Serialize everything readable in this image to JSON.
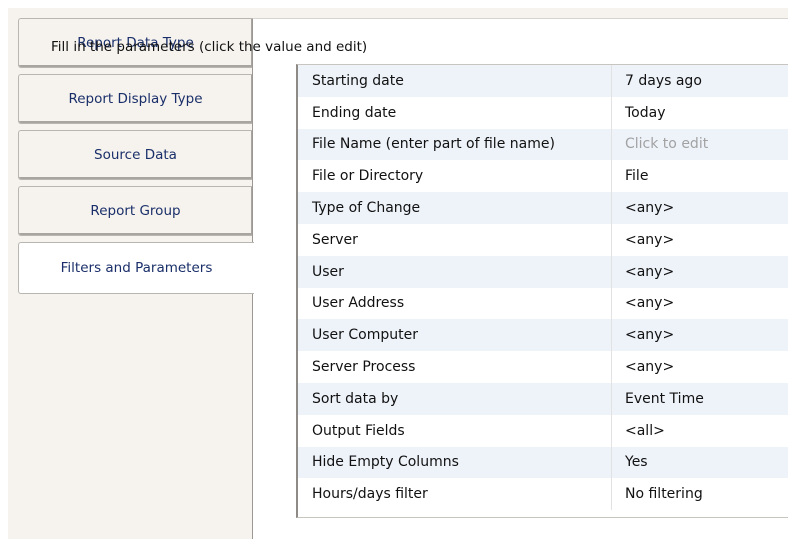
{
  "tabs": [
    {
      "label": "Report Data Type",
      "active": false
    },
    {
      "label": "Report Display Type",
      "active": false
    },
    {
      "label": "Source Data",
      "active": false
    },
    {
      "label": "Report Group",
      "active": false
    },
    {
      "label": "Filters and Parameters",
      "active": true
    }
  ],
  "panel": {
    "instruction": "Fill in the parameters (click the value and edit)"
  },
  "params": [
    {
      "name": "Starting date",
      "value": "7 days ago"
    },
    {
      "name": "Ending date",
      "value": "Today"
    },
    {
      "name": "File Name (enter part of file name)",
      "value": "Click to edit",
      "placeholder": true
    },
    {
      "name": "File or Directory",
      "value": "File"
    },
    {
      "name": "Type of Change",
      "value": "<any>"
    },
    {
      "name": "Server",
      "value": "<any>"
    },
    {
      "name": "User",
      "value": "<any>"
    },
    {
      "name": "User Address",
      "value": "<any>"
    },
    {
      "name": "User Computer",
      "value": "<any>"
    },
    {
      "name": "Server Process",
      "value": "<any>"
    },
    {
      "name": "Sort data by",
      "value": "Event Time"
    },
    {
      "name": "Output Fields",
      "value": "<all>"
    },
    {
      "name": "Hide Empty Columns",
      "value": "Yes"
    },
    {
      "name": "Hours/days filter",
      "value": "No filtering"
    }
  ],
  "colors": {
    "tab_text": "#1a2f6a",
    "row_alt": "#eef3fa",
    "placeholder_text": "#a2a2a2"
  }
}
